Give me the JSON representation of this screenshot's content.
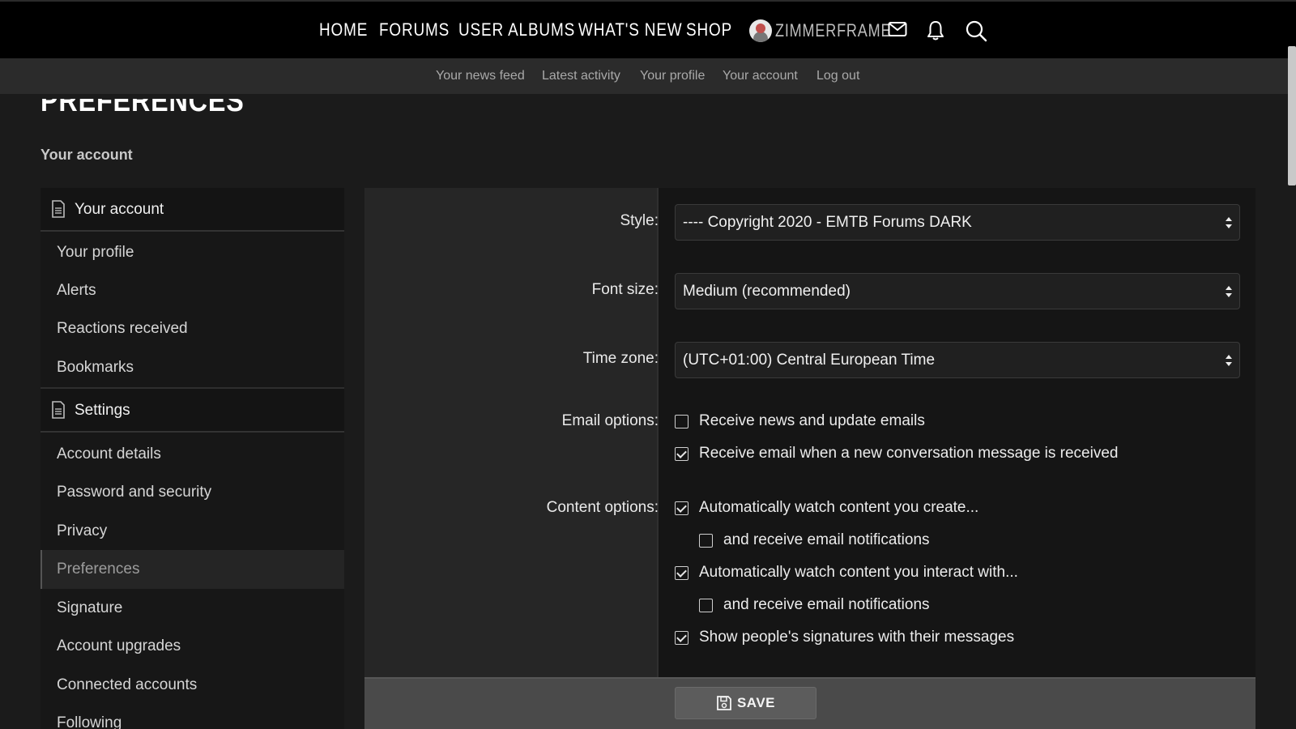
{
  "topnav": {
    "links": [
      "HOME",
      "FORUMS",
      "USER ALBUMS",
      "WHAT'S NEW",
      "SHOP"
    ],
    "username": "ZIMMERFRAME",
    "icons": [
      "envelope-icon",
      "bell-icon",
      "search-icon"
    ]
  },
  "subnav": {
    "links": [
      "Your news feed",
      "Latest activity",
      "Your profile",
      "Your account",
      "Log out"
    ]
  },
  "page": {
    "title": "PREFERENCES",
    "breadcrumb": "Your account"
  },
  "sidebar": {
    "account_header": "Your account",
    "account_items": [
      "Your profile",
      "Alerts",
      "Reactions received",
      "Bookmarks"
    ],
    "settings_header": "Settings",
    "settings_items": [
      "Account details",
      "Password and security",
      "Privacy",
      "Preferences",
      "Signature",
      "Account upgrades",
      "Connected accounts",
      "Following"
    ],
    "active_item": "Preferences"
  },
  "form": {
    "style_label": "Style:",
    "style_value": "---- Copyright 2020 - EMTB Forums DARK",
    "font_size_label": "Font size:",
    "font_size_value": "Medium (recommended)",
    "time_zone_label": "Time zone:",
    "time_zone_value": "(UTC+01:00) Central European Time",
    "email_options_label": "Email options:",
    "email_options": [
      {
        "label": "Receive news and update emails",
        "checked": false
      },
      {
        "label": "Receive email when a new conversation message is received",
        "checked": true
      }
    ],
    "content_options_label": "Content options:",
    "content_options": [
      {
        "label": "Automatically watch content you create...",
        "checked": true
      },
      {
        "label": "and receive email notifications",
        "checked": false
      },
      {
        "label": "Automatically watch content you interact with...",
        "checked": true
      },
      {
        "label": "and receive email notifications",
        "checked": false
      },
      {
        "label": "Show people's signatures with their messages",
        "checked": true
      }
    ],
    "save_label": "SAVE"
  }
}
